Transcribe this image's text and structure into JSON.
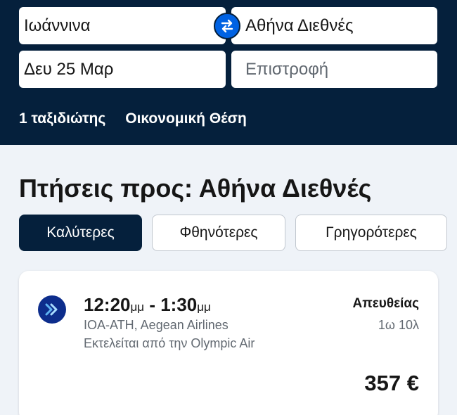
{
  "search": {
    "origin": "Ιωάννινα",
    "destination": "Αθήνα Διεθνές",
    "depart_date": "Δευ 25 Μαρ",
    "return_placeholder": "Επιστροφή",
    "travellers": "1 ταξιδιώτης",
    "cabin_class": "Οικονομική Θέση"
  },
  "results": {
    "title": "Πτήσεις προς: Αθήνα Διεθνές"
  },
  "sort_tabs": [
    {
      "label": "Καλύτερες",
      "active": true
    },
    {
      "label": "Φθηνότερες",
      "active": false
    },
    {
      "label": "Γρηγορότερες",
      "active": false
    }
  ],
  "flight": {
    "depart_time": "12:20",
    "depart_ampm": "μμ",
    "separator": " - ",
    "arrive_time": "1:30",
    "arrive_ampm": "μμ",
    "route_airline": "IOA-ATH, Aegean Airlines",
    "operated_by": "Εκτελείται από την Olympic Air",
    "stops": "Απευθείας",
    "duration": "1ω 10λ",
    "price": "357 €",
    "logo_icon": "aegean-chevron-icon"
  },
  "colors": {
    "header_bg": "#05203c",
    "accent_blue": "#0062e3",
    "page_bg": "#eff3f8",
    "logo_bg": "#0d2d8c"
  }
}
